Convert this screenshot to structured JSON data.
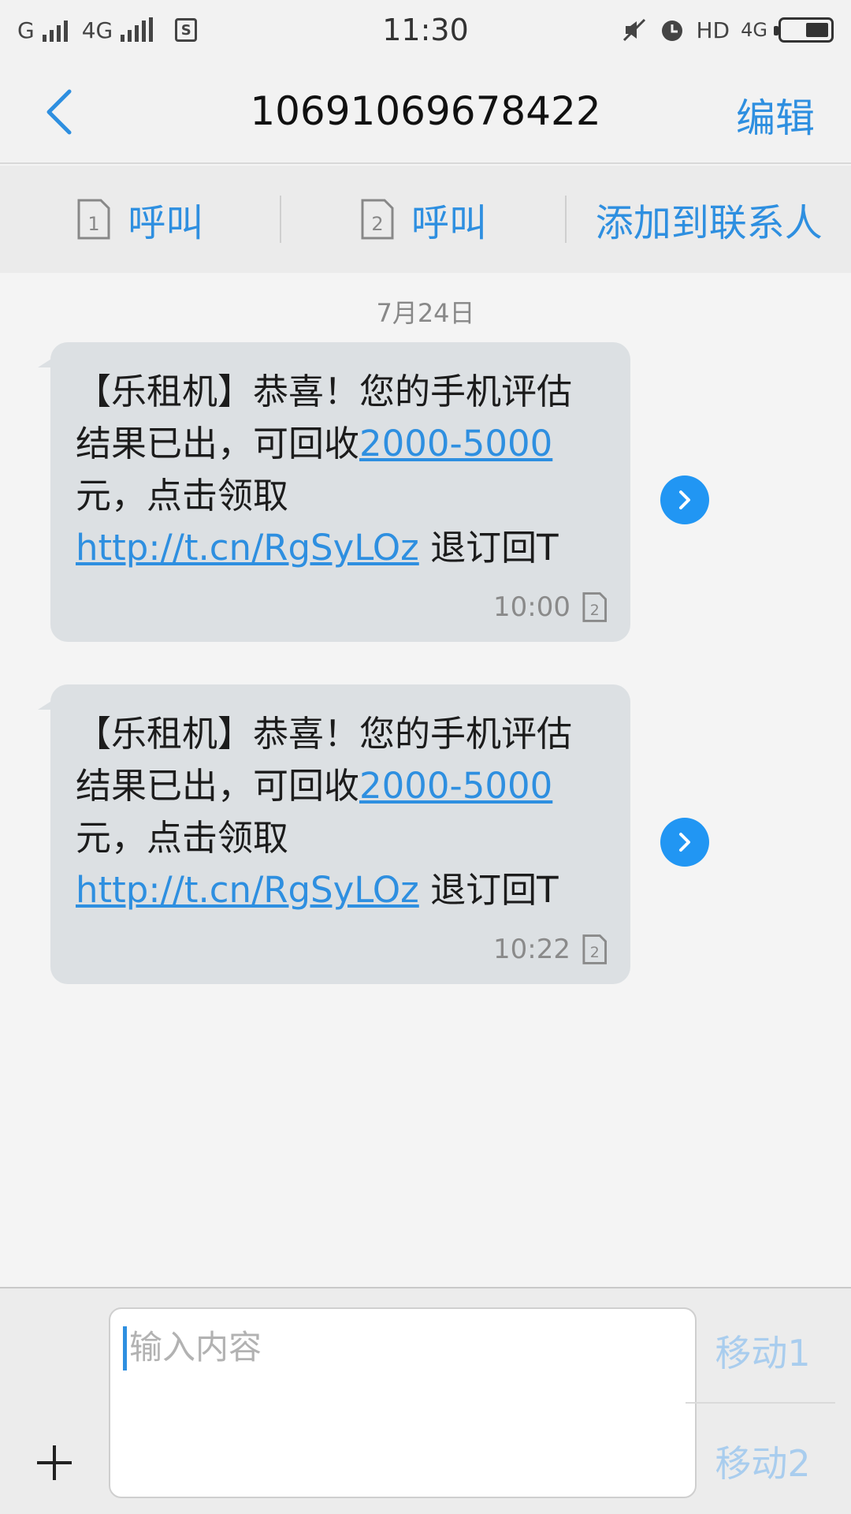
{
  "status_bar": {
    "carrier1": "G",
    "carrier2": "4G",
    "time": "11:30",
    "hd": "HD",
    "net": "4G"
  },
  "header": {
    "title": "10691069678422",
    "edit_label": "编辑"
  },
  "actions": {
    "call1_label": "呼叫",
    "call2_label": "呼叫",
    "add_contact_label": "添加到联系人",
    "sim1": "1",
    "sim2": "2"
  },
  "date_label": "7月24日",
  "messages": [
    {
      "text_prefix": "【乐租机】恭喜！您的手机评估结果已出，可回收",
      "link_amount": "2000-5000",
      "text_mid": "元，点击领取 ",
      "link_url": "http://t.cn/RgSyLOz",
      "text_suffix": " 退订回T",
      "time": "10:00",
      "sim": "2"
    },
    {
      "text_prefix": "【乐租机】恭喜！您的手机评估结果已出，可回收",
      "link_amount": "2000-5000",
      "text_mid": "元，点击领取 ",
      "link_url": "http://t.cn/RgSyLOz",
      "text_suffix": " 退订回T",
      "time": "10:22",
      "sim": "2"
    }
  ],
  "composer": {
    "placeholder": "输入内容",
    "send1_label": "移动1",
    "send2_label": "移动2"
  },
  "colors": {
    "accent": "#2e8fe0",
    "bubble": "#dce0e3",
    "forward": "#2196f3"
  }
}
